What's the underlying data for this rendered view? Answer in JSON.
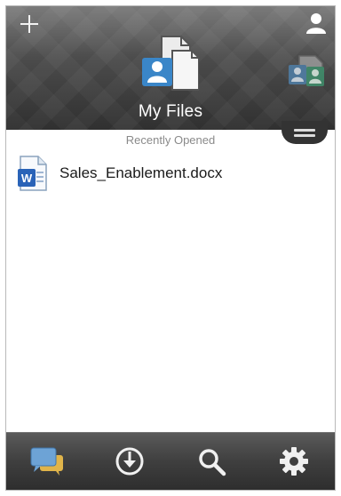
{
  "header": {
    "title": "My Files",
    "add_icon": "plus-icon",
    "account_icon": "user-icon",
    "files_icon": "documents-icon",
    "shared_icon": "shared-files-icon",
    "menu_icon": "menu-icon"
  },
  "content": {
    "section_label": "Recently Opened",
    "files": [
      {
        "name": "Sales_Enablement.docx",
        "icon": "word-document-icon"
      }
    ]
  },
  "toolbar": {
    "items": [
      {
        "icon": "chat-icon"
      },
      {
        "icon": "download-icon"
      },
      {
        "icon": "search-icon"
      },
      {
        "icon": "gear-icon"
      }
    ]
  },
  "colors": {
    "header_dark": "#303030",
    "header_light": "#6b6b6b",
    "accent_blue": "#2a78b8",
    "shared_green": "#3a8a6a",
    "chat_blue": "#5b93c9",
    "chat_yellow": "#e0b44a"
  }
}
